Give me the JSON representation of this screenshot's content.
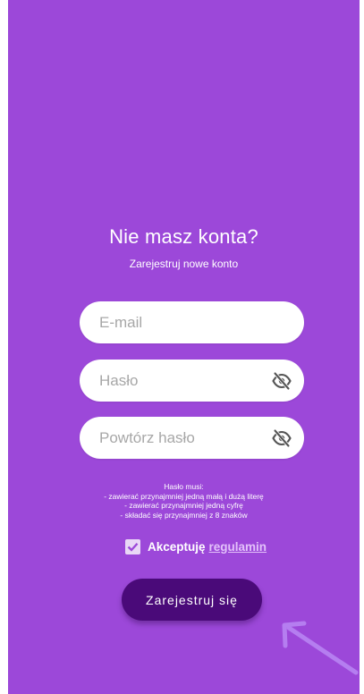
{
  "page": {
    "title": "Nie masz konta?",
    "subtitle": "Zarejestruj nowe konto"
  },
  "form": {
    "email": {
      "placeholder": "E-mail",
      "value": ""
    },
    "password": {
      "placeholder": "Hasło",
      "value": "",
      "icon": "eye-off-icon"
    },
    "repeat_password": {
      "placeholder": "Powtórz hasło",
      "value": "",
      "icon": "eye-off-icon"
    }
  },
  "rules": {
    "heading": "Hasło musi:",
    "items": [
      "- zawierać przynajmniej jedną małą i dużą literę",
      "- zawierać przynajmniej jedną cyfrę",
      "- składać się przynajmniej z 8 znaków"
    ]
  },
  "terms": {
    "checked": true,
    "label": "Akceptuję",
    "link": "regulamin"
  },
  "actions": {
    "register_label": "Zarejestruj się"
  },
  "colors": {
    "background": "#9c48d9",
    "button": "#4a0a79",
    "link": "#e3c1fa",
    "arrow": "#b57ef0"
  }
}
